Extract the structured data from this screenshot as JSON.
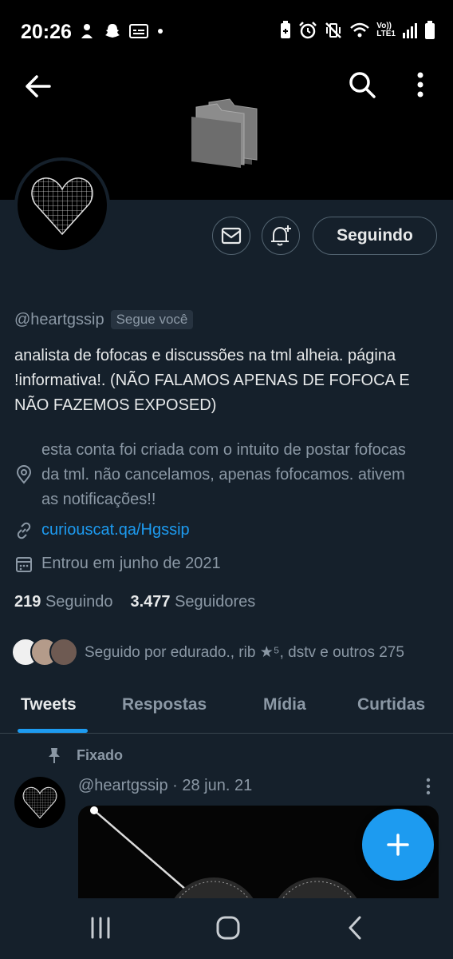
{
  "status_bar": {
    "time": "20:26",
    "left_icons": [
      "hand-gesture-icon",
      "snapchat-icon",
      "gallery-notification-icon",
      "dot-icon"
    ],
    "right_icons": [
      "battery-saver-icon",
      "alarm-icon",
      "vibrate-mute-icon",
      "wifi-icon",
      "volte-icon",
      "signal-icon",
      "battery-icon"
    ],
    "network_label_top": "Vo))",
    "network_label_bottom": "LTE1"
  },
  "header": {
    "back_icon": "arrow-left-icon",
    "search_icon": "search-icon",
    "menu_icon": "more-vertical-icon",
    "banner_icon": "folder-icon"
  },
  "profile": {
    "handle": "@heartgssip",
    "follows_you_badge": "Segue você",
    "bio": "analista de fofocas e discussões na tml alheia. página !informativa!. (NÃO FALAMOS APENAS DE FOFOCA E NÃO FAZEMOS EXPOSED)",
    "location": "esta conta foi criada com o intuito de postar fofocas da tml. não cancelamos, apenas fofocamos. ativem as notificações!!",
    "link": "curiouscat.qa/Hgssip",
    "joined": "Entrou em junho de 2021",
    "following_count": "219",
    "following_label": "Seguindo",
    "followers_count": "3.477",
    "followers_label": "Seguidores",
    "followed_by": "Seguido por edurado., rib ★⁵, dstv e outros 275"
  },
  "actions": {
    "message_icon": "envelope-icon",
    "notify_icon": "bell-plus-icon",
    "follow_label": "Seguindo"
  },
  "tabs": [
    {
      "label": "Tweets",
      "active": true
    },
    {
      "label": "Respostas",
      "active": false
    },
    {
      "label": "Mídia",
      "active": false
    },
    {
      "label": "Curtidas",
      "active": false
    }
  ],
  "tweet": {
    "pinned_label": "Fixado",
    "header": "@heartgssip · 28 jun. 21"
  },
  "colors": {
    "background": "#15202b",
    "accent": "#1d9bf0",
    "muted": "#8b98a5"
  },
  "navbar": {
    "icons": [
      "recent-apps-icon",
      "home-icon",
      "back-icon"
    ]
  }
}
